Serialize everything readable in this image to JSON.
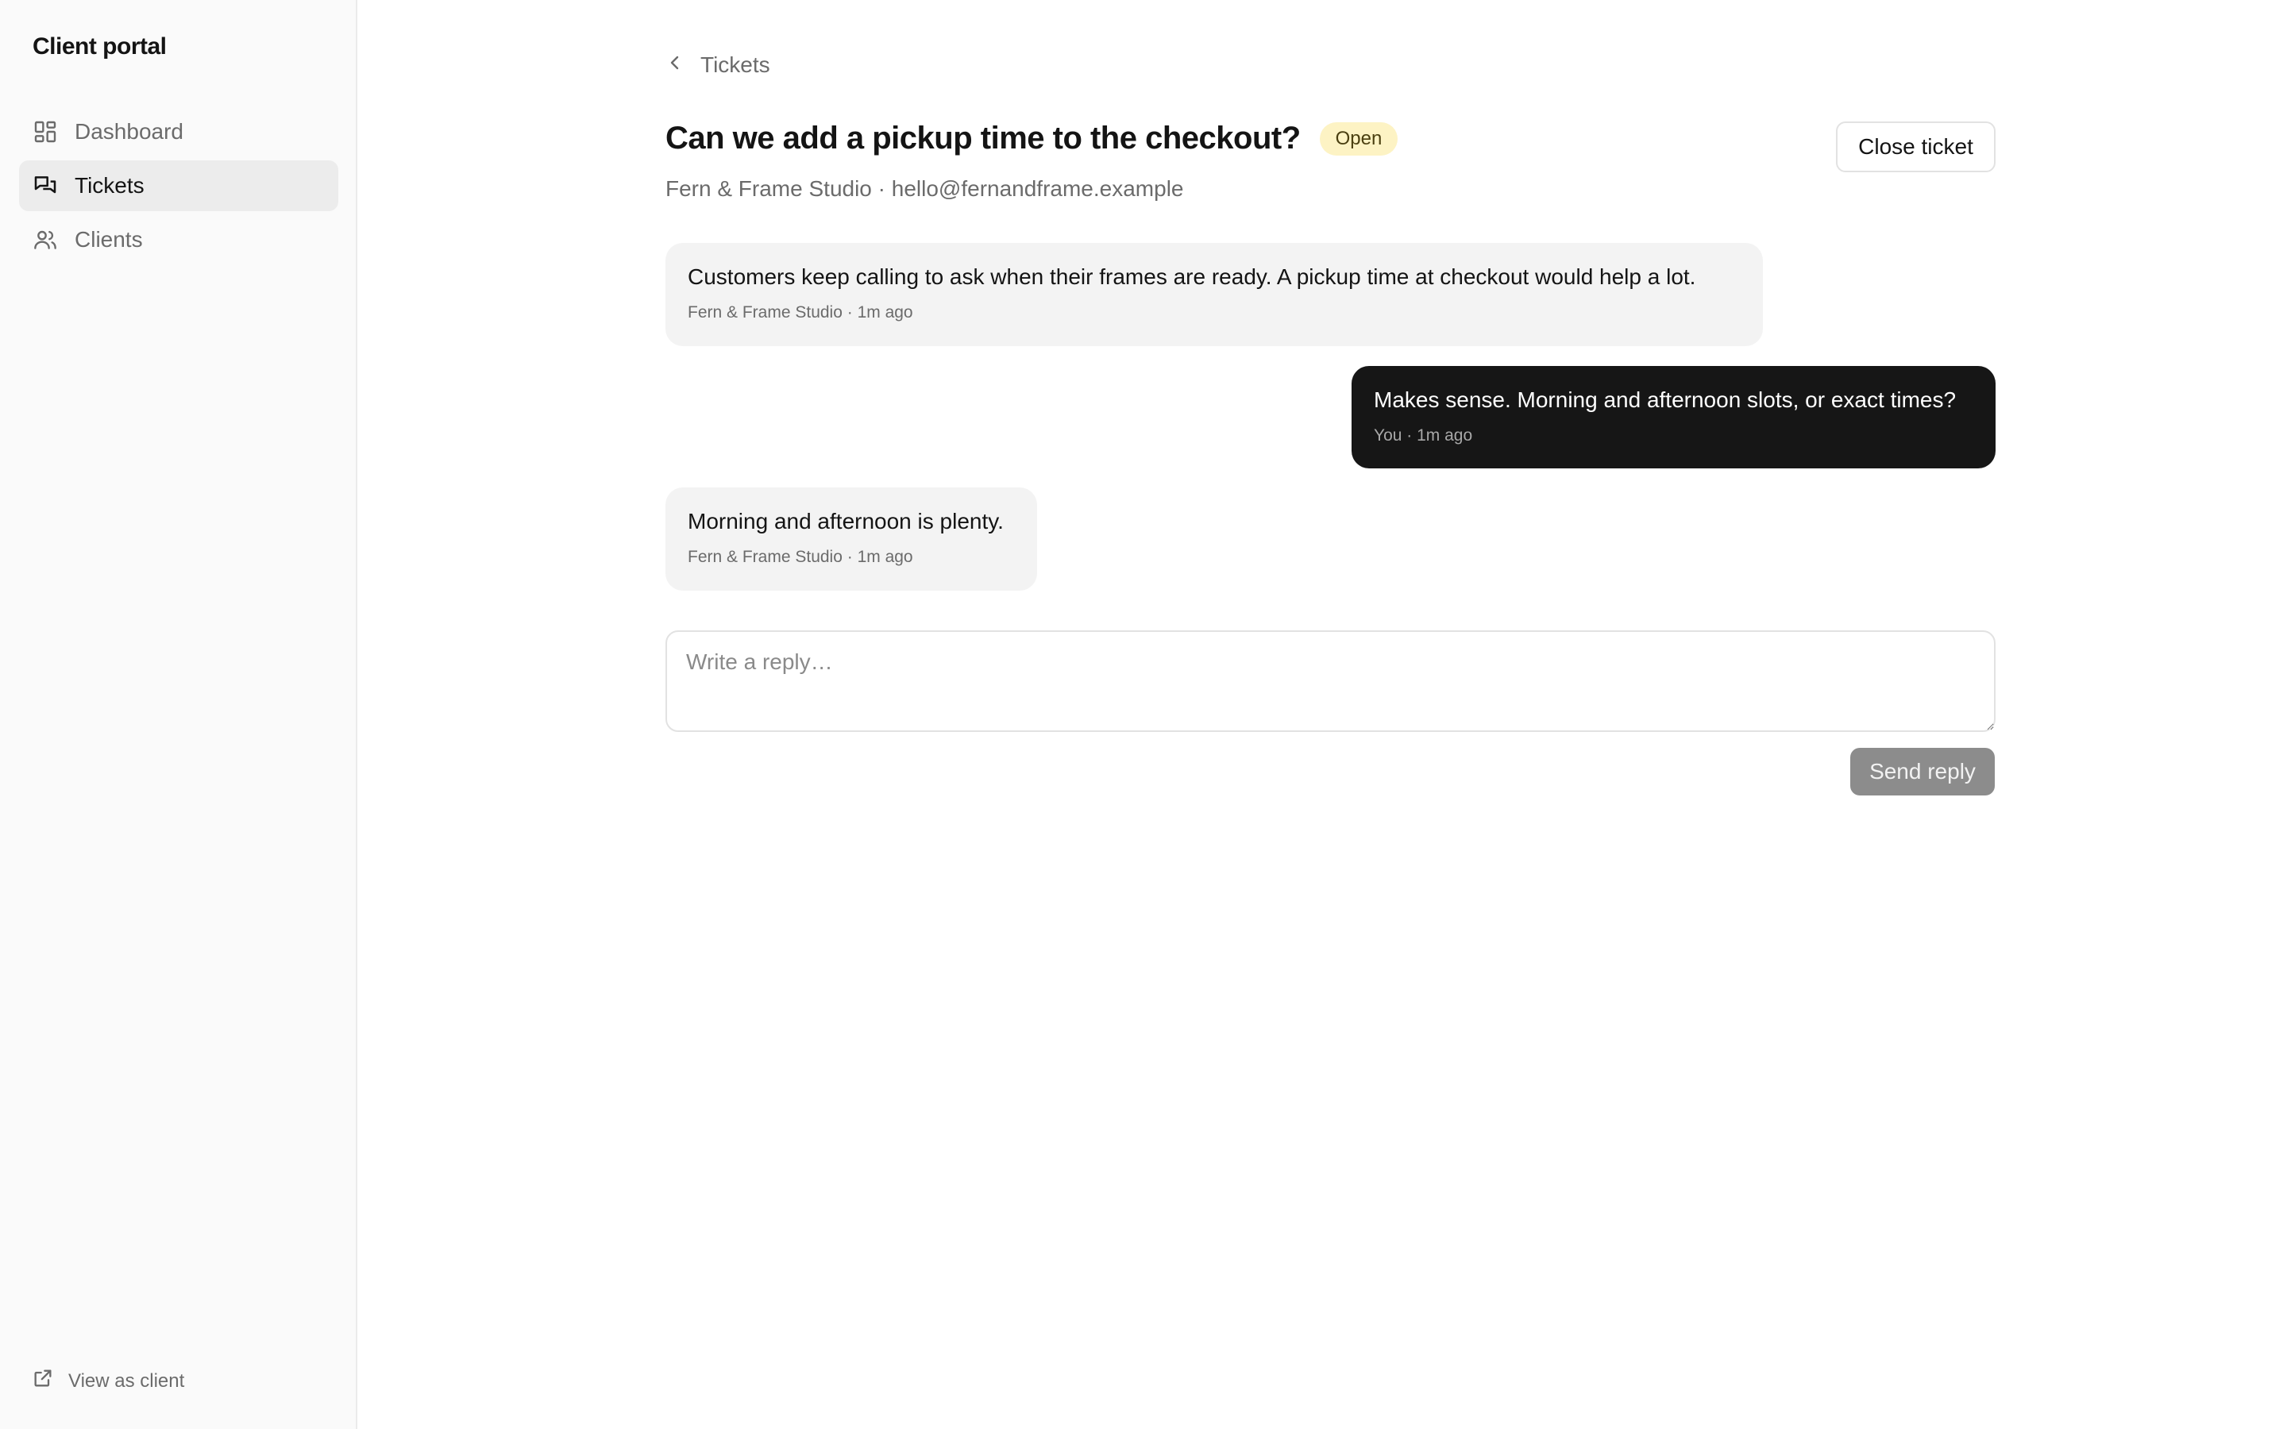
{
  "sidebar": {
    "brand": "Client portal",
    "items": [
      {
        "label": "Dashboard",
        "icon": "dashboard-grid-icon",
        "active": false
      },
      {
        "label": "Tickets",
        "icon": "chat-bubbles-icon",
        "active": true
      },
      {
        "label": "Clients",
        "icon": "users-icon",
        "active": false
      }
    ],
    "footer_link": {
      "label": "View as client",
      "icon": "external-link-icon"
    }
  },
  "main": {
    "breadcrumb": "Tickets",
    "title": "Can we add a pickup time to the checkout?",
    "status": "Open",
    "subtitle": "Fern & Frame Studio · hello@fernandframe.example",
    "close_button": "Close ticket",
    "messages": [
      {
        "text": "Customers keep calling to ask when their frames are ready. A pickup time at checkout would help a lot.",
        "meta": "Fern & Frame Studio · 1m ago",
        "direction": "in"
      },
      {
        "text": "Makes sense. Morning and afternoon slots, or exact times?",
        "meta": "You · 1m ago",
        "direction": "out"
      },
      {
        "text": "Morning and afternoon is plenty.",
        "meta": "Fern & Frame Studio · 1m ago",
        "direction": "in"
      }
    ],
    "reply": {
      "placeholder": "Write a reply…",
      "value": ""
    },
    "send_button": "Send reply"
  },
  "colors": {
    "sidebar_bg": "#fafafa",
    "active_item_bg": "#ececec",
    "badge_bg": "#fdf3c4",
    "outgoing_bubble": "#161616",
    "incoming_bubble": "#f3f3f3",
    "send_button_disabled": "#8c8c8c"
  }
}
